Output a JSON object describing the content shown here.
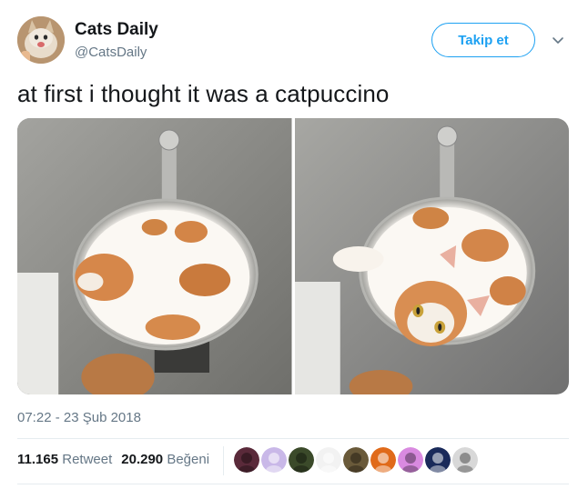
{
  "user": {
    "display_name": "Cats Daily",
    "handle": "@CatsDaily",
    "avatar_icon": "cat-avatar-icon"
  },
  "follow_button": {
    "label": "Takip et",
    "color": "#1da1f2"
  },
  "tweet": {
    "text": "at first i thought it was a catpuccino",
    "timestamp": "07:22 - 23 Şub 2018"
  },
  "stats": {
    "retweets": {
      "count": "11.165",
      "label": "Retweet"
    },
    "likes": {
      "count": "20.290",
      "label": "Beğeni"
    }
  },
  "likers": [
    {
      "icon": "liker-avatar-1",
      "color": "#5a2a3a"
    },
    {
      "icon": "liker-avatar-2",
      "color": "#c9b8e8"
    },
    {
      "icon": "liker-avatar-3",
      "color": "#3b4a2a"
    },
    {
      "icon": "liker-avatar-4",
      "color": "#f2f2f2"
    },
    {
      "icon": "liker-avatar-5",
      "color": "#6a5a3a"
    },
    {
      "icon": "liker-avatar-6",
      "color": "#e06a1a"
    },
    {
      "icon": "liker-avatar-7",
      "color": "#d98ae0"
    },
    {
      "icon": "liker-avatar-8",
      "color": "#1a2a5a"
    },
    {
      "icon": "liker-avatar-9",
      "color": "#d8d8d8"
    }
  ],
  "colors": {
    "text_primary": "#14171a",
    "text_secondary": "#657786",
    "divider": "#e6ecf0"
  }
}
